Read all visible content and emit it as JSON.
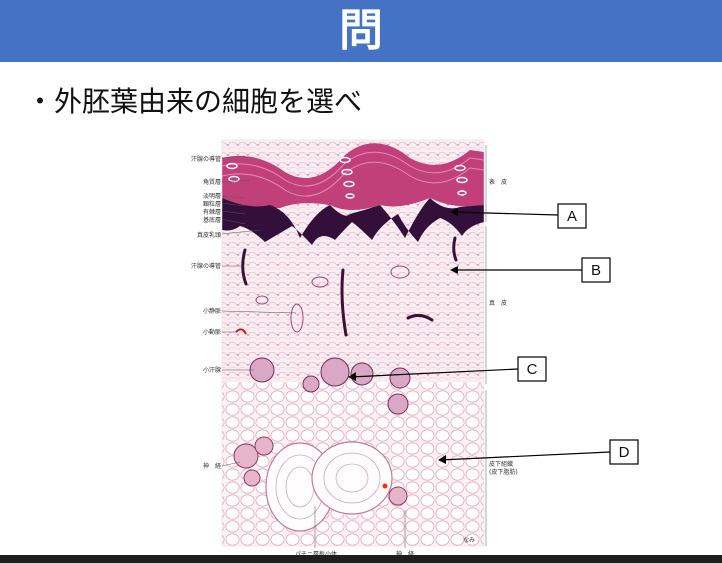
{
  "header": {
    "title": "問"
  },
  "question": {
    "bullet": "・",
    "text": "外胚葉由来の細胞を選べ"
  },
  "figure": {
    "left_labels": [
      "汗腺の導管",
      "角質層",
      "淡明層",
      "顆粒層",
      "有棘層",
      "基底層",
      "真皮乳頭",
      "汗腺の導管",
      "小静脈",
      "小動脈",
      "小汗腺",
      "神　経"
    ],
    "right_labels": [
      "表　皮",
      "真　皮",
      "皮下組織",
      "(皮下脂肪)"
    ],
    "bottom_labels": [
      "パチニ層板小体",
      "神　経"
    ],
    "signature": "なみ"
  },
  "answer_boxes": [
    "A",
    "B",
    "C",
    "D"
  ],
  "colors": {
    "header_bg": "#4472c4",
    "header_text": "#ffffff",
    "bottom_bar": "#1e1e1e"
  }
}
